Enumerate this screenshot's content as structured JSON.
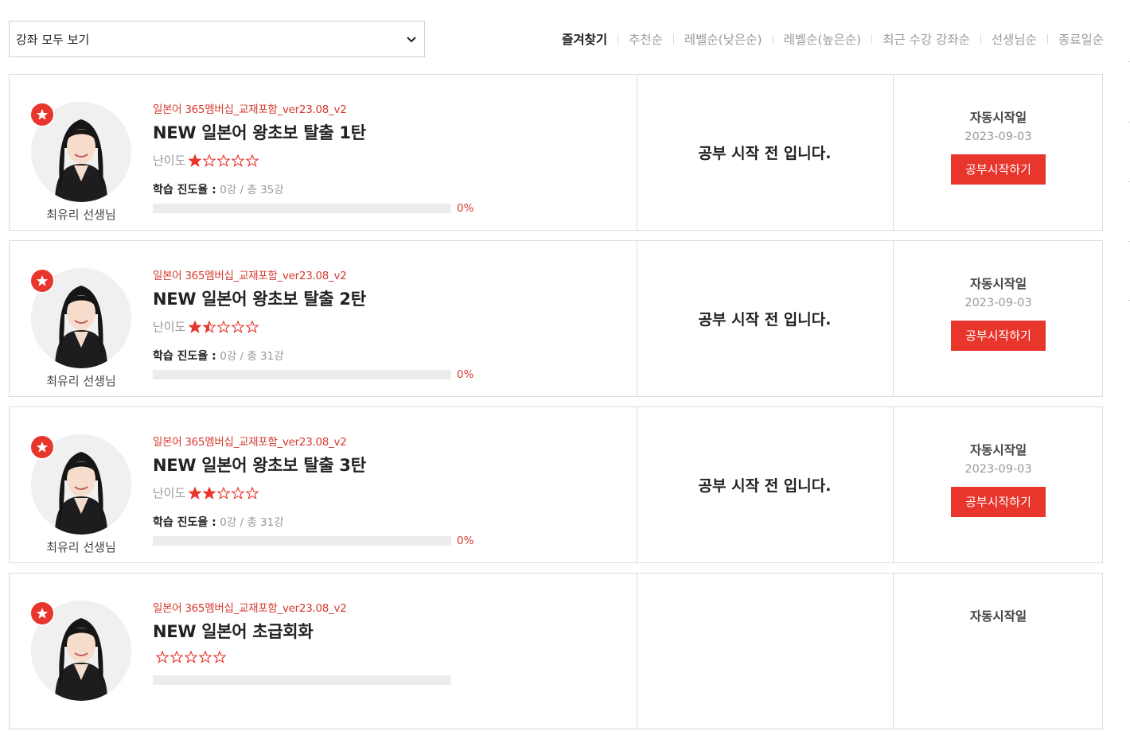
{
  "filter": {
    "selected": "강좌 모두 보기"
  },
  "sorts": [
    {
      "label": "즐겨찾기",
      "active": true
    },
    {
      "label": "추천순",
      "active": false
    },
    {
      "label": "레벨순(낮은순)",
      "active": false
    },
    {
      "label": "레벨순(높은순)",
      "active": false
    },
    {
      "label": "최근 수강 강좌순",
      "active": false
    },
    {
      "label": "선생님순",
      "active": false
    },
    {
      "label": "종료일순",
      "active": false
    }
  ],
  "colors": {
    "accent": "#e8362d",
    "muted": "#999999",
    "border": "#dcdcdc"
  },
  "courses": [
    {
      "teacher": "최유리 선생님",
      "tag": "일본어 365멤버십_교재포함_ver23.08_v2",
      "title": "NEW 일본어 왕초보 탈출 1탄",
      "difficulty_label": "난이도",
      "difficulty": 1,
      "progress_label": "학습 진도율 :",
      "progress_value": "0강 / 총 35강",
      "progress_pct": "0%",
      "status": "공부 시작 전 입니다.",
      "auto_label": "자동시작일",
      "auto_date": "2023-09-03",
      "button": "공부시작하기"
    },
    {
      "teacher": "최유리 선생님",
      "tag": "일본어 365멤버십_교재포함_ver23.08_v2",
      "title": "NEW 일본어 왕초보 탈출 2탄",
      "difficulty_label": "난이도",
      "difficulty": 1.5,
      "progress_label": "학습 진도율 :",
      "progress_value": "0강 / 총 31강",
      "progress_pct": "0%",
      "status": "공부 시작 전 입니다.",
      "auto_label": "자동시작일",
      "auto_date": "2023-09-03",
      "button": "공부시작하기"
    },
    {
      "teacher": "최유리 선생님",
      "tag": "일본어 365멤버십_교재포함_ver23.08_v2",
      "title": "NEW 일본어 왕초보 탈출 3탄",
      "difficulty_label": "난이도",
      "difficulty": 2,
      "progress_label": "학습 진도율 :",
      "progress_value": "0강 / 총 31강",
      "progress_pct": "0%",
      "status": "공부 시작 전 입니다.",
      "auto_label": "자동시작일",
      "auto_date": "2023-09-03",
      "button": "공부시작하기"
    },
    {
      "teacher": "",
      "tag": "일본어 365멤버십_교재포함_ver23.08_v2",
      "title": "NEW 일본어 초급회화",
      "difficulty_label": "",
      "difficulty": 0,
      "progress_label": "",
      "progress_value": "",
      "progress_pct": "",
      "status": "",
      "auto_label": "자동시작일",
      "auto_date": "",
      "button": ""
    }
  ]
}
